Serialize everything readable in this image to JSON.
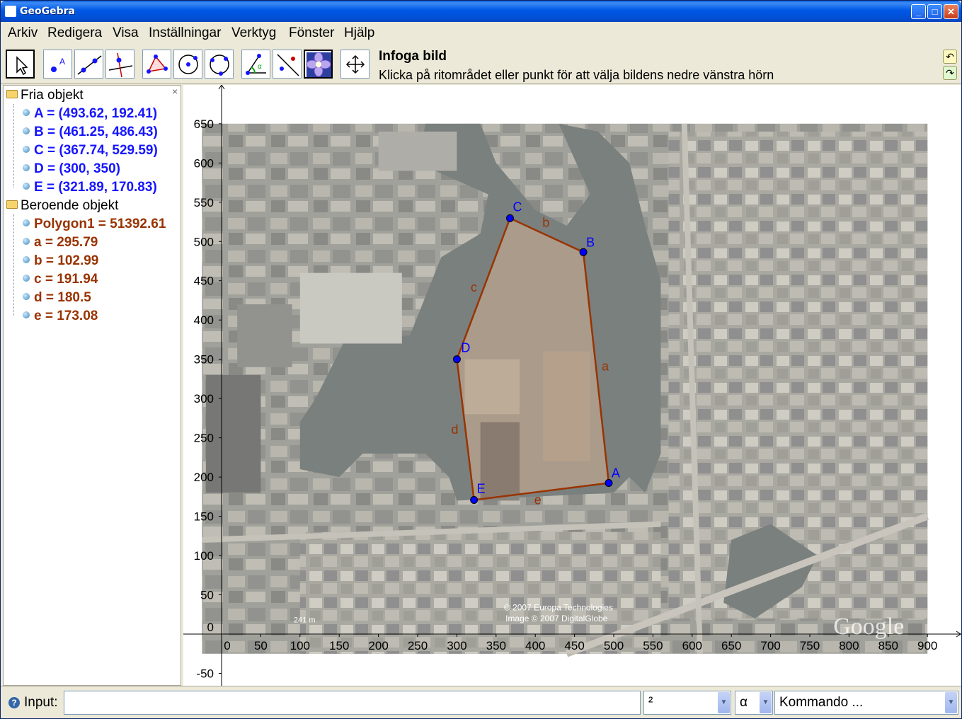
{
  "window": {
    "title": "GeoGebra"
  },
  "menu": [
    "Arkiv",
    "Redigera",
    "Visa",
    "Inställningar",
    "Verktyg",
    "Fönster",
    "Hjälp"
  ],
  "toolbar": {
    "tools": [
      "move-tool",
      "point-tool",
      "line-tool",
      "perpendicular-tool",
      "polygon-tool",
      "circle-tool",
      "conic-tool",
      "angle-tool",
      "reflect-tool",
      "image-tool",
      "pan-tool"
    ],
    "selected_tool": "image-tool",
    "active_tool_title": "Infoga bild",
    "active_tool_help": "Klicka på ritområdet eller punkt för att välja bildens nedre vänstra hörn"
  },
  "algebra": {
    "free_header": "Fria objekt",
    "free": [
      "A = (493.62, 192.41)",
      "B = (461.25, 486.43)",
      "C = (367.74, 529.59)",
      "D = (300, 350)",
      "E = (321.89, 170.83)"
    ],
    "dependent_header": "Beroende objekt",
    "dependent": [
      "Polygon1 = 51392.61",
      "a = 295.79",
      "b = 102.99",
      "c = 191.94",
      "d = 180.5",
      "e = 173.08"
    ]
  },
  "graphics": {
    "x_ticks": [
      0,
      50,
      100,
      150,
      200,
      250,
      300,
      350,
      400,
      450,
      500,
      550,
      600,
      650,
      700,
      750,
      800,
      850,
      900
    ],
    "y_ticks": [
      -50,
      0,
      50,
      100,
      150,
      200,
      250,
      300,
      350,
      400,
      450,
      500,
      550,
      600,
      650
    ],
    "points": [
      {
        "name": "A",
        "x": 493.62,
        "y": 192.41
      },
      {
        "name": "B",
        "x": 461.25,
        "y": 486.43
      },
      {
        "name": "C",
        "x": 367.74,
        "y": 529.59
      },
      {
        "name": "D",
        "x": 300,
        "y": 350
      },
      {
        "name": "E",
        "x": 321.89,
        "y": 170.83
      }
    ],
    "segments": [
      {
        "name": "a",
        "from": "A",
        "to": "B"
      },
      {
        "name": "b",
        "from": "B",
        "to": "C"
      },
      {
        "name": "c",
        "from": "C",
        "to": "D"
      },
      {
        "name": "d",
        "from": "D",
        "to": "E"
      },
      {
        "name": "e",
        "from": "E",
        "to": "A"
      }
    ],
    "colors": {
      "point": "#0000ff",
      "polygon": "#993300",
      "point_label": "#0000ff",
      "segment_label": "#993300"
    },
    "image_credits": [
      "© 2007 Europa Technologies",
      "Image © 2007 DigitalGlobe"
    ],
    "image_scale_label": "241 m",
    "image_logo": "Google"
  },
  "input": {
    "label": "Input:",
    "value": "",
    "combo_power": "²",
    "combo_greek": "α",
    "combo_command": "Kommando ..."
  }
}
